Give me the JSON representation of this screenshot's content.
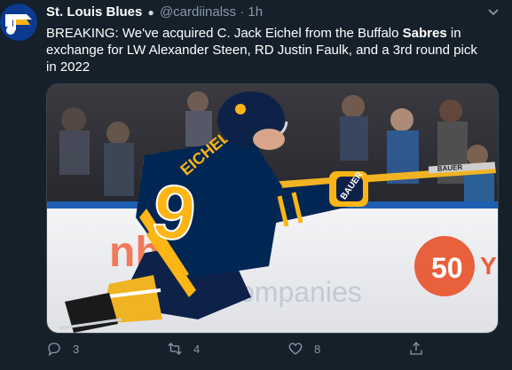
{
  "tweet": {
    "display_name": "St. Louis Blues",
    "badge": "●",
    "handle": "@cardiinalss",
    "separator": "·",
    "time": "1h",
    "text_before_bold": "BREAKING: We've acquired C. Jack Eichel from the Buffalo ",
    "text_bold": "Sabres",
    "text_after_bold": " in exchange for LW Alexander Steen, RD Justin Faulk, and a 3rd round pick in 2022"
  },
  "media": {
    "jersey_name": "EICHEL",
    "jersey_number": "9",
    "board_text_1": "nhtown",
    "board_text_2": "companies",
    "board_badge_text": "50",
    "board_badge_suffix": "Y",
    "stick_brand": "BAUER",
    "glove_brand": "BAUER"
  },
  "actions": {
    "reply_count": "3",
    "retweet_count": "4",
    "like_count": "8"
  },
  "colors": {
    "background": "#15202b",
    "secondary_text": "#8899a6",
    "sabres_navy": "#002654",
    "sabres_gold": "#fcb514",
    "blues_blue": "#0b3a8f"
  }
}
